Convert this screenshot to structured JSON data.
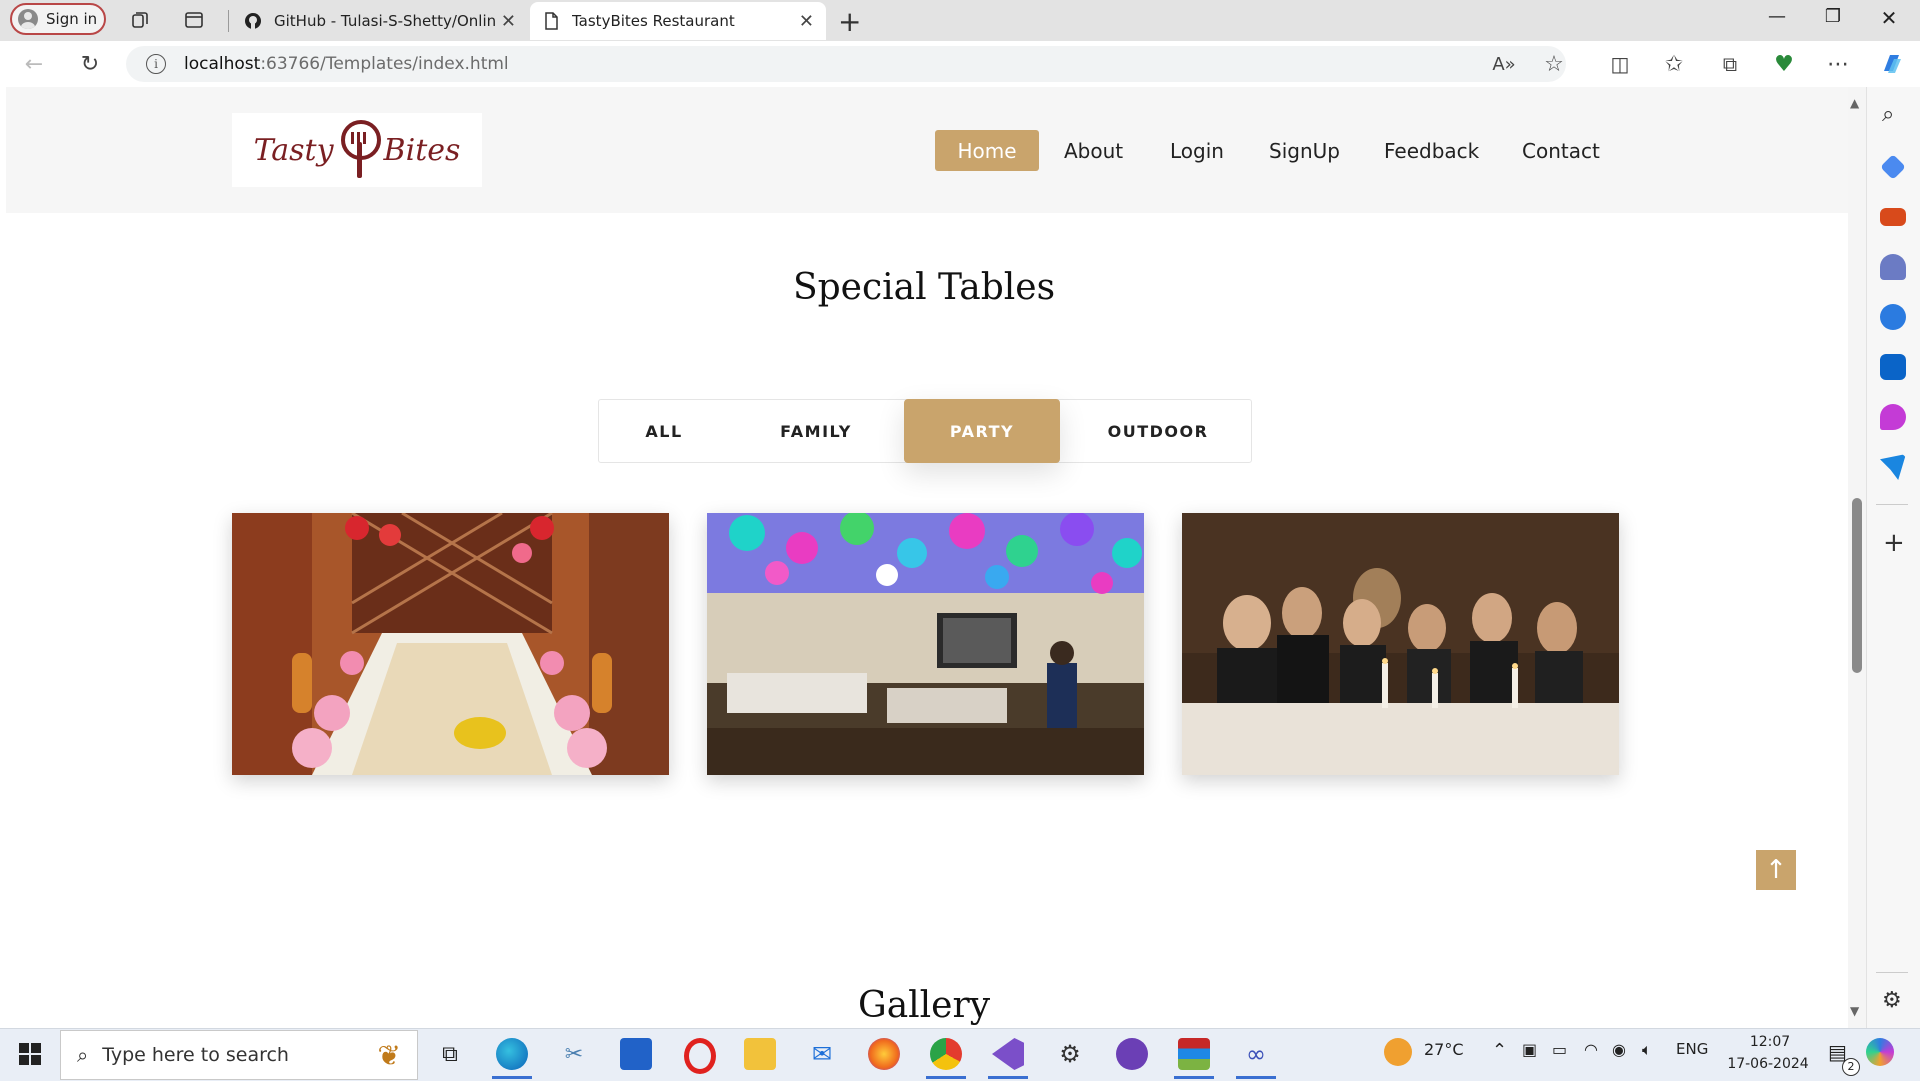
{
  "browser": {
    "signin_label": "Sign in",
    "tabs": [
      {
        "title": "GitHub - Tulasi-S-Shetty/Online-",
        "active": false
      },
      {
        "title": "TastyBites Restaurant",
        "active": true
      }
    ],
    "url_host": "localhost",
    "url_path": ":63766/Templates/index.html"
  },
  "site": {
    "logo_left": "Tasty",
    "logo_right": "Bites",
    "nav": [
      "Home",
      "About",
      "Login",
      "SignUp",
      "Feedback",
      "Contact"
    ],
    "nav_active": "Home",
    "section_title": "Special Tables",
    "filters": [
      "ALL",
      "FAMILY",
      "PARTY",
      "OUTDOOR"
    ],
    "filter_active": "PARTY",
    "next_section_title": "Gallery",
    "back_to_top_icon": "arrow-up-icon",
    "accent_color": "#c9a46c",
    "brand_color": "#7a1f22"
  },
  "taskbar": {
    "search_placeholder": "Type here to search",
    "weather": "27°C",
    "language": "ENG",
    "time": "12:07",
    "date": "17-06-2024",
    "notifications": "2"
  }
}
